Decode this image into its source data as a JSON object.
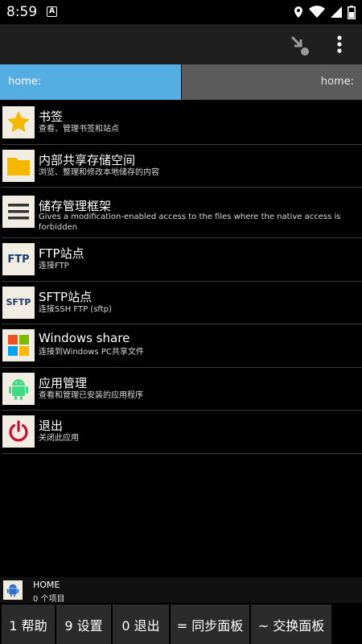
{
  "status": {
    "time": "8:59",
    "app_icon": "A"
  },
  "toolbar": {
    "icons": [
      "select-arrow-icon",
      "overflow-menu-icon"
    ]
  },
  "paths": {
    "left": "home:",
    "right": "home:"
  },
  "items": [
    {
      "title": "书签",
      "subtitle": "查看、管理书签和站点",
      "icon": "star-icon"
    },
    {
      "title": "内部共享存储空间",
      "subtitle": "浏览、整理和修改本地储存的内容",
      "icon": "folder-icon"
    },
    {
      "title": "储存管理框架",
      "subtitle": "Gives a modification-enabled access to the files where the native access is forbidden",
      "icon": "menu-lines-icon"
    },
    {
      "title": "FTP站点",
      "subtitle": "连接FTP",
      "icon": "ftp-icon",
      "icon_text": "FTP"
    },
    {
      "title": "SFTP站点",
      "subtitle": "连接SSH FTP (sftp)",
      "icon": "sftp-icon",
      "icon_text": "SFTP"
    },
    {
      "title": "Windows share",
      "subtitle": "连接到Windows PC共享文件",
      "icon": "windows-icon"
    },
    {
      "title": "应用管理",
      "subtitle": "查看和管理已安装的应用程序",
      "icon": "android-icon"
    },
    {
      "title": "退出",
      "subtitle": "关闭此应用",
      "icon": "power-icon"
    }
  ],
  "bottom": {
    "title": "HOME",
    "subtitle": "0 个项目"
  },
  "function_keys": [
    "1 帮助",
    "9 设置",
    "0 退出",
    "= 同步面板",
    "~ 交换面板"
  ],
  "colors": {
    "active_panel": "#55aee3",
    "inactive_panel": "#5b5b5b",
    "toolbar": "#1f1f1f",
    "fkey": "#2b2b2b"
  }
}
